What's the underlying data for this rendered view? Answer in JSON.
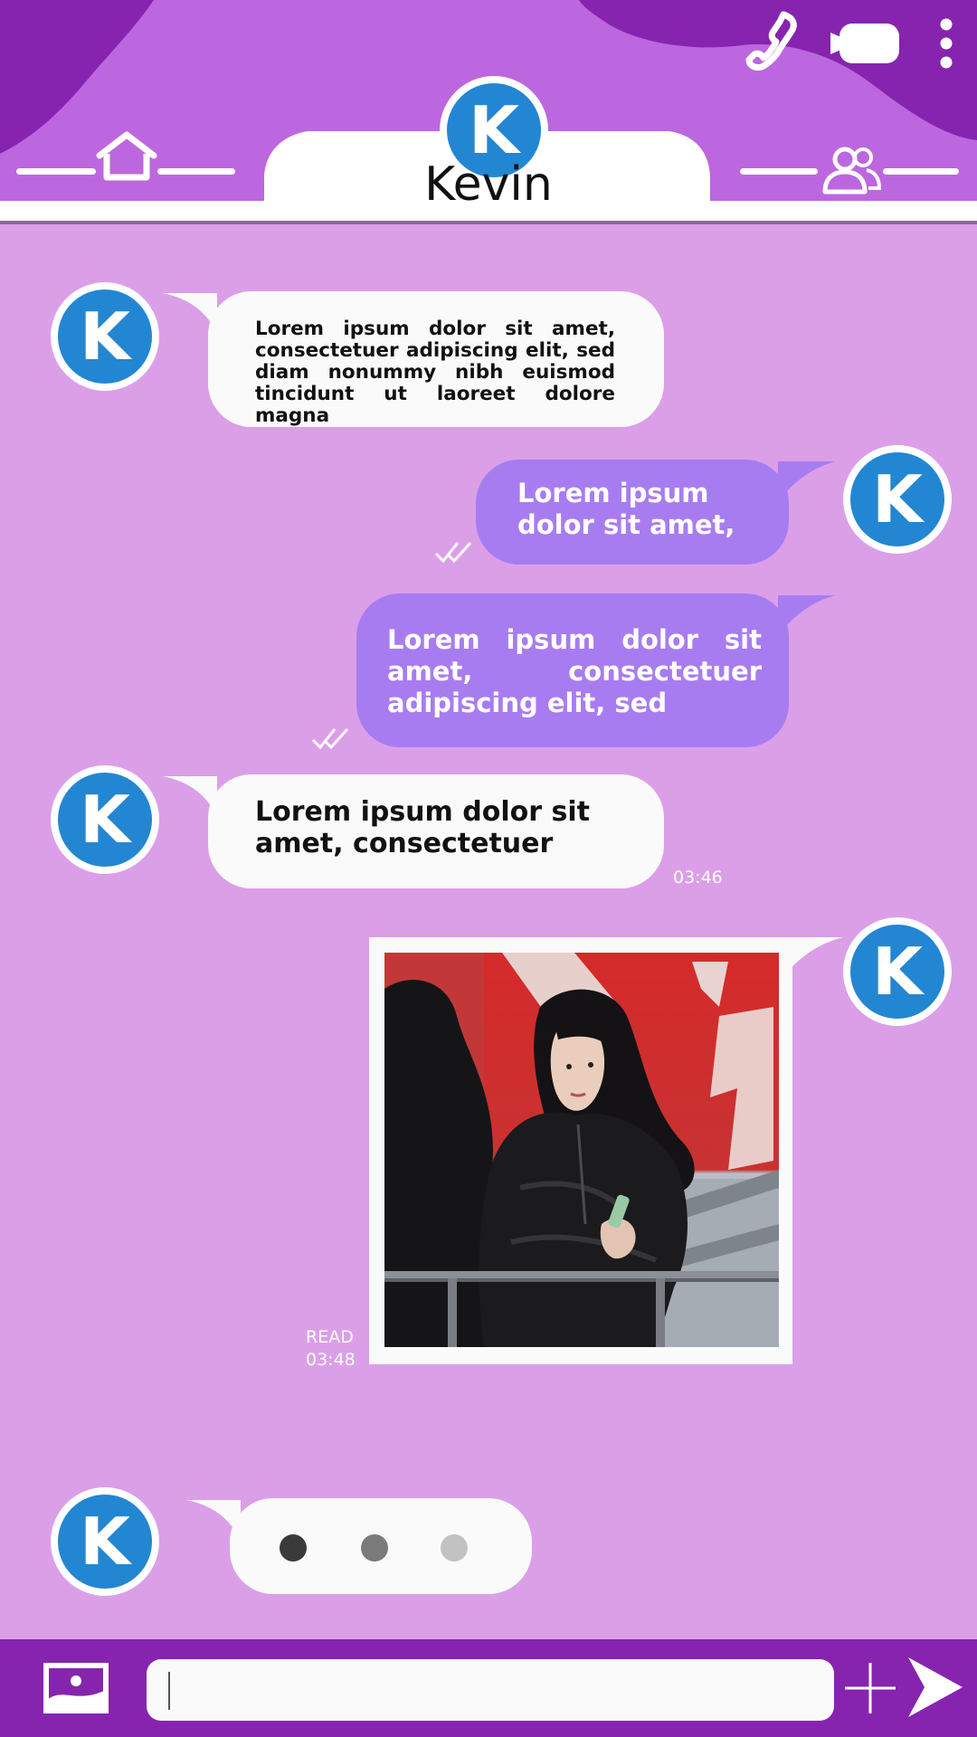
{
  "header": {
    "contact_name": "Kevin",
    "avatar_initial": "K",
    "icons": [
      "home-icon",
      "phone-icon",
      "video-icon",
      "more-vertical-icon",
      "group-icon"
    ]
  },
  "messages": [
    {
      "direction": "incoming",
      "text": "Lorem ipsum dolor sit amet, consectetuer adipiscing elit, sed diam nonummy nibh euismod tincidunt ut laoreet dolore magna"
    },
    {
      "direction": "outgoing",
      "text": "Lorem ipsum dolor sit amet,",
      "status_icon": "double-check-icon"
    },
    {
      "direction": "outgoing",
      "text": "Lorem ipsum dolor sit amet, consectetuer adipiscing elit, sed",
      "status_icon": "double-check-icon"
    },
    {
      "direction": "incoming",
      "text": "Lorem ipsum dolor sit amet, consectetuer",
      "time": "03:46"
    },
    {
      "direction": "outgoing",
      "type": "photo",
      "status": "READ",
      "time": "03:48",
      "image_alt": "photo-woman-black-jacket"
    }
  ],
  "typing_indicator": {
    "dot_colors": [
      "#3A3A3A",
      "#7A7A7A",
      "#C2C2C2"
    ]
  },
  "composer": {
    "placeholder": "",
    "icons": [
      "image-icon",
      "plus-icon",
      "send-icon"
    ]
  },
  "colors": {
    "background": "#DB9FE8",
    "header": "#BC67DF",
    "header_dark": "#8624AF",
    "outgoing_bubble": "#A87CF1",
    "incoming_bubble": "#FAFAFA",
    "avatar": "#2386D2"
  }
}
